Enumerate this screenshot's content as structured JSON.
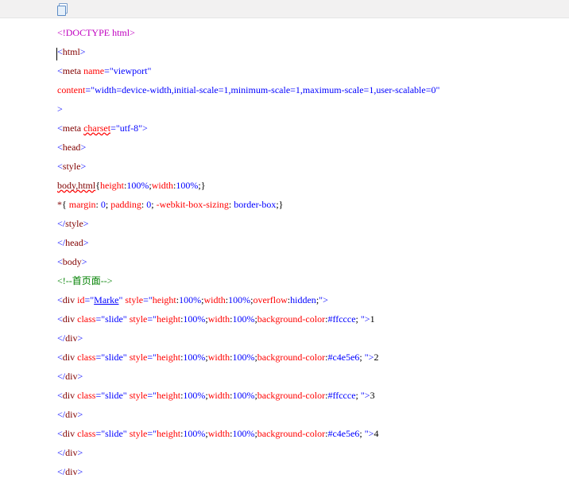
{
  "toolbar": {
    "copy_label": "copy"
  },
  "colors": {
    "doctype": "#c000c0",
    "punct": "#0000ff",
    "tag": "#800000",
    "attr": "#ff0000",
    "comment": "#008000"
  },
  "code": {
    "lines": [
      {
        "type": "doctype",
        "raw": "<!DOCTYPE html>"
      },
      {
        "type": "open_tag",
        "tag": "html",
        "cursor": true
      },
      {
        "type": "open_tag_attrs",
        "tag": "meta",
        "attrs": [
          {
            "name": "name",
            "value": "viewport"
          }
        ],
        "no_close": true
      },
      {
        "type": "attr_line",
        "name": "content",
        "value": "width=device-width,initial-scale=1,minimum-scale=1,maximum-scale=1,user-scalable=0"
      },
      {
        "type": "close_only"
      },
      {
        "type": "open_tag_attrs",
        "tag": "meta",
        "attrs": [
          {
            "name": "charset",
            "value": "utf-8",
            "underline": true
          }
        ],
        "self_close": true
      },
      {
        "type": "open_tag",
        "tag": "head"
      },
      {
        "type": "open_tag",
        "tag": "style"
      },
      {
        "type": "css_rule",
        "selector": "body,html",
        "underline": true,
        "decls": [
          {
            "prop": "height",
            "val": "100%"
          },
          {
            "prop": "width",
            "val": "100%"
          }
        ],
        "trailing_semi": true
      },
      {
        "type": "css_rule",
        "selector": "*",
        "decls": [
          {
            "prop": "margin",
            "val": "0",
            "space": true
          },
          {
            "prop": "padding",
            "val": "0",
            "space": true
          },
          {
            "prop": "-webkit-box-sizing",
            "val": "border-box",
            "space": true
          }
        ]
      },
      {
        "type": "close_tag",
        "tag": "style"
      },
      {
        "type": "close_tag",
        "tag": "head"
      },
      {
        "type": "open_tag",
        "tag": "body"
      },
      {
        "type": "comment",
        "text": "首页面"
      },
      {
        "type": "div_open",
        "id": "Marke",
        "underline_id": true,
        "style": "height:100%;width:100%;overflow:hidden;"
      },
      {
        "type": "div_open",
        "cls": "slide",
        "style": "height:100%;width:100%;background-color:#ffccce;",
        "trail_space": true,
        "content": "1"
      },
      {
        "type": "close_tag",
        "tag": "div"
      },
      {
        "type": "div_open",
        "cls": "slide",
        "style": "height:100%;width:100%;background-color:#c4e5e6;",
        "trail_space": true,
        "content": "2"
      },
      {
        "type": "close_tag",
        "tag": "div"
      },
      {
        "type": "div_open",
        "cls": "slide",
        "style": "height:100%;width:100%;background-color:#ffccce;",
        "trail_space": true,
        "content": "3"
      },
      {
        "type": "close_tag",
        "tag": "div"
      },
      {
        "type": "div_open",
        "cls": "slide",
        "style": "height:100%;width:100%;background-color:#c4e5e6;",
        "trail_space": true,
        "content": "4"
      },
      {
        "type": "close_tag",
        "tag": "div"
      },
      {
        "type": "close_tag",
        "tag": "div"
      }
    ]
  }
}
